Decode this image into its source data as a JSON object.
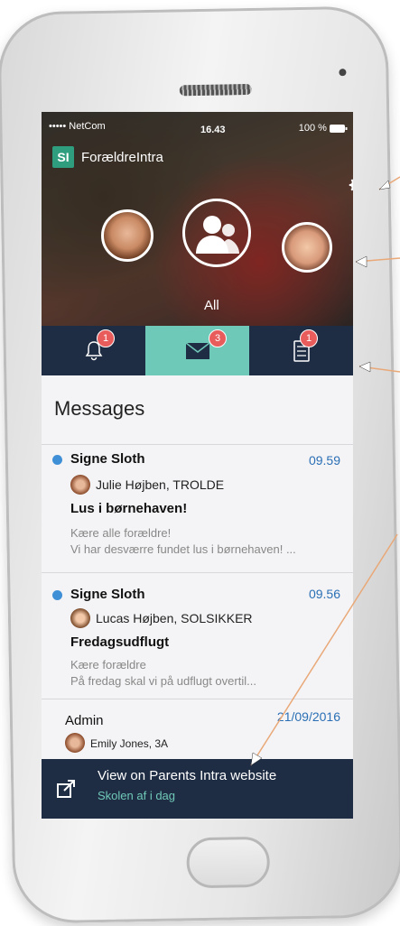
{
  "status_bar": {
    "carrier": "••••• NetCom",
    "time": "16.43",
    "battery": "100 %"
  },
  "app": {
    "logo": "SI",
    "title": "ForældreIntra"
  },
  "hero": {
    "all_label": "All"
  },
  "tabs": [
    {
      "name": "notifications",
      "icon": "bell-icon",
      "badge": "1"
    },
    {
      "name": "messages",
      "icon": "mail-icon",
      "badge": "3"
    },
    {
      "name": "tasks",
      "icon": "checklist-icon",
      "badge": "1"
    }
  ],
  "messages": {
    "heading": "Messages",
    "items": [
      {
        "sender": "Signe Sloth",
        "time": "09.59",
        "child": "Julie Højben, TROLDE",
        "subject": "Lus i børnehaven!",
        "preview1": "Kære alle forældre!",
        "preview2": "Vi har desværre fundet lus i børnehaven! ...",
        "unread": true
      },
      {
        "sender": "Signe Sloth",
        "time": "09.56",
        "child": "Lucas Højben, SOLSIKKER",
        "subject": "Fredagsudflugt",
        "preview1": "Kære forældre",
        "preview2": "På fredag skal vi på udflugt overtil...",
        "unread": true
      },
      {
        "sender": "Admin",
        "time": "21/09/2016",
        "child": "Emily Jones, 3A",
        "subject": "",
        "preview1": "",
        "preview2": "",
        "unread": false
      }
    ]
  },
  "footer": {
    "title": "View on Parents Intra website",
    "subtitle": "Skolen af i dag",
    "icon": "external-link-icon"
  },
  "colors": {
    "navy": "#1f2d44",
    "teal": "#6fc9b8",
    "badge": "#e85c5c",
    "unread": "#3f8fd6",
    "time": "#2a6fb5"
  }
}
